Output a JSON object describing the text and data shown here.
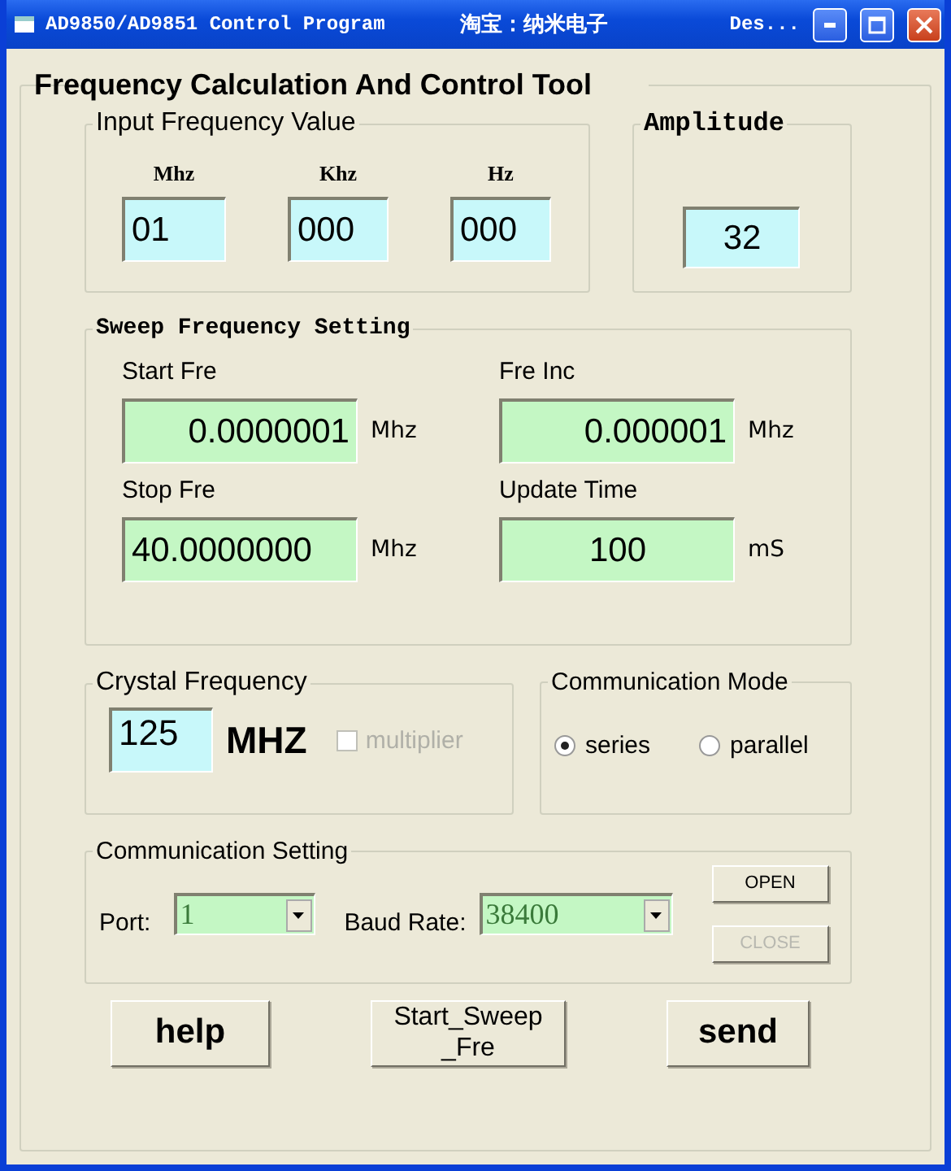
{
  "window": {
    "title": "AD9850/AD9851 Control Program",
    "subtitle": "淘宝：纳米电子",
    "title_extra": "Des..."
  },
  "main_group": {
    "title": "Frequency Calculation And Control Tool"
  },
  "input_frequency": {
    "title": "Input Frequency Value",
    "fields": [
      {
        "label": "Mhz",
        "value": "01"
      },
      {
        "label": "Khz",
        "value": "000"
      },
      {
        "label": "Hz",
        "value": "000"
      }
    ]
  },
  "amplitude": {
    "title": "Amplitude",
    "value": "32"
  },
  "sweep": {
    "title": "Sweep Frequency Setting",
    "fields": [
      {
        "label": "Start Fre",
        "value": "0.0000001",
        "unit": "Mhz"
      },
      {
        "label": "Fre Inc",
        "value": "0.000001",
        "unit": "Mhz"
      },
      {
        "label": "Stop Fre",
        "value": "40.0000000",
        "unit": "Mhz"
      },
      {
        "label": "Update Time",
        "value": "100",
        "unit": "mS"
      }
    ]
  },
  "crystal": {
    "title": "Crystal Frequency",
    "value": "125",
    "unit": "MHZ",
    "multiplier": {
      "label": "multiplier",
      "checked": false,
      "disabled": true
    }
  },
  "comm_mode": {
    "title": "Communication Mode",
    "options": [
      {
        "label": "series",
        "selected": true
      },
      {
        "label": "parallel",
        "selected": false
      }
    ]
  },
  "comm_setting": {
    "title": "Communication Setting",
    "port": {
      "label": "Port:",
      "value": "1"
    },
    "baud": {
      "label": "Baud Rate:",
      "value": "38400"
    },
    "buttons": [
      {
        "label": "OPEN",
        "disabled": false
      },
      {
        "label": "CLOSE",
        "disabled": true
      }
    ]
  },
  "buttons": [
    {
      "label": "help"
    },
    {
      "label": "Start_Sweep\n_Fre"
    },
    {
      "label": "send"
    }
  ]
}
